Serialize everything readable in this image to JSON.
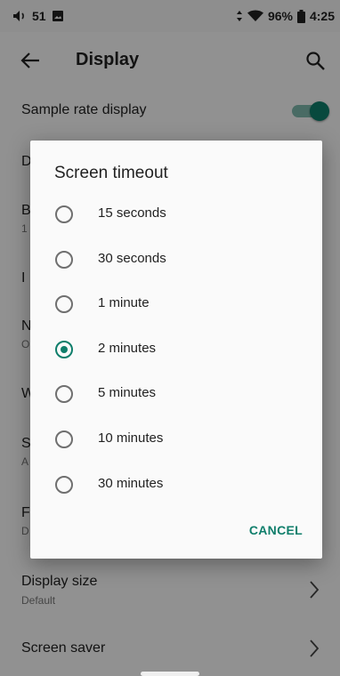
{
  "status_bar": {
    "volume_level": "51",
    "battery_percent": "96%",
    "time": "4:25"
  },
  "app_bar": {
    "title": "Display"
  },
  "settings": {
    "sample_rate_display": {
      "label": "Sample rate display",
      "enabled": true
    },
    "partial_rows": [
      {
        "title": "D",
        "subtitle": ""
      },
      {
        "title": "B",
        "subtitle": "1"
      },
      {
        "title": "I",
        "subtitle": ""
      },
      {
        "title": "N",
        "subtitle": "O"
      },
      {
        "title": "W",
        "subtitle": ""
      },
      {
        "title": "S",
        "subtitle": "A"
      },
      {
        "title": "F",
        "subtitle": "D"
      }
    ],
    "display_size": {
      "title": "Display size",
      "subtitle": "Default"
    },
    "screen_saver": {
      "title": "Screen saver"
    }
  },
  "dialog": {
    "title": "Screen timeout",
    "options": [
      {
        "label": "15 seconds",
        "checked": false
      },
      {
        "label": "30 seconds",
        "checked": false
      },
      {
        "label": "1 minute",
        "checked": false
      },
      {
        "label": "2 minutes",
        "checked": true
      },
      {
        "label": "5 minutes",
        "checked": false
      },
      {
        "label": "10 minutes",
        "checked": false
      },
      {
        "label": "30 minutes",
        "checked": false
      }
    ],
    "cancel_label": "CANCEL"
  },
  "colors": {
    "accent": "#0f7e6b",
    "scrim": "rgba(0,0,0,0.42)"
  }
}
